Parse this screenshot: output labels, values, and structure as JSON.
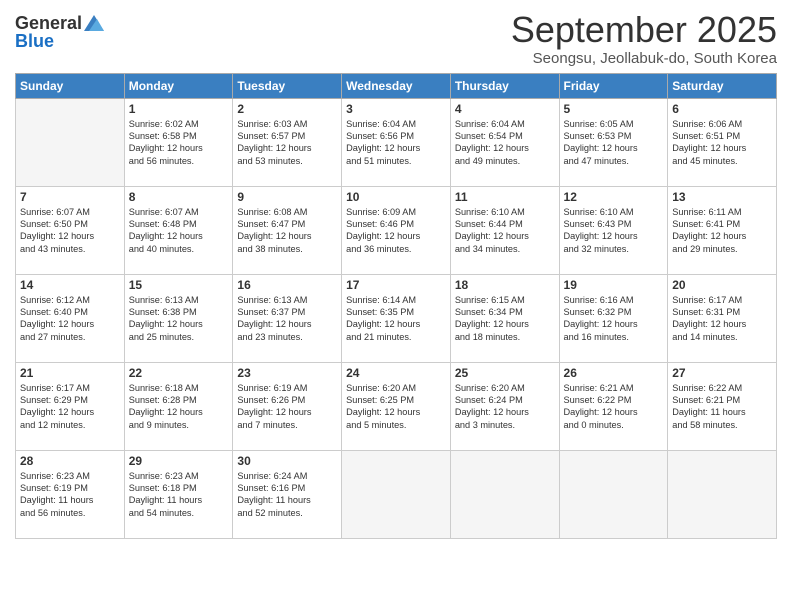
{
  "header": {
    "logo_general": "General",
    "logo_blue": "Blue",
    "month_title": "September 2025",
    "subtitle": "Seongsu, Jeollabuk-do, South Korea"
  },
  "days_of_week": [
    "Sunday",
    "Monday",
    "Tuesday",
    "Wednesday",
    "Thursday",
    "Friday",
    "Saturday"
  ],
  "weeks": [
    [
      {
        "day": "",
        "info": ""
      },
      {
        "day": "1",
        "info": "Sunrise: 6:02 AM\nSunset: 6:58 PM\nDaylight: 12 hours\nand 56 minutes."
      },
      {
        "day": "2",
        "info": "Sunrise: 6:03 AM\nSunset: 6:57 PM\nDaylight: 12 hours\nand 53 minutes."
      },
      {
        "day": "3",
        "info": "Sunrise: 6:04 AM\nSunset: 6:56 PM\nDaylight: 12 hours\nand 51 minutes."
      },
      {
        "day": "4",
        "info": "Sunrise: 6:04 AM\nSunset: 6:54 PM\nDaylight: 12 hours\nand 49 minutes."
      },
      {
        "day": "5",
        "info": "Sunrise: 6:05 AM\nSunset: 6:53 PM\nDaylight: 12 hours\nand 47 minutes."
      },
      {
        "day": "6",
        "info": "Sunrise: 6:06 AM\nSunset: 6:51 PM\nDaylight: 12 hours\nand 45 minutes."
      }
    ],
    [
      {
        "day": "7",
        "info": "Sunrise: 6:07 AM\nSunset: 6:50 PM\nDaylight: 12 hours\nand 43 minutes."
      },
      {
        "day": "8",
        "info": "Sunrise: 6:07 AM\nSunset: 6:48 PM\nDaylight: 12 hours\nand 40 minutes."
      },
      {
        "day": "9",
        "info": "Sunrise: 6:08 AM\nSunset: 6:47 PM\nDaylight: 12 hours\nand 38 minutes."
      },
      {
        "day": "10",
        "info": "Sunrise: 6:09 AM\nSunset: 6:46 PM\nDaylight: 12 hours\nand 36 minutes."
      },
      {
        "day": "11",
        "info": "Sunrise: 6:10 AM\nSunset: 6:44 PM\nDaylight: 12 hours\nand 34 minutes."
      },
      {
        "day": "12",
        "info": "Sunrise: 6:10 AM\nSunset: 6:43 PM\nDaylight: 12 hours\nand 32 minutes."
      },
      {
        "day": "13",
        "info": "Sunrise: 6:11 AM\nSunset: 6:41 PM\nDaylight: 12 hours\nand 29 minutes."
      }
    ],
    [
      {
        "day": "14",
        "info": "Sunrise: 6:12 AM\nSunset: 6:40 PM\nDaylight: 12 hours\nand 27 minutes."
      },
      {
        "day": "15",
        "info": "Sunrise: 6:13 AM\nSunset: 6:38 PM\nDaylight: 12 hours\nand 25 minutes."
      },
      {
        "day": "16",
        "info": "Sunrise: 6:13 AM\nSunset: 6:37 PM\nDaylight: 12 hours\nand 23 minutes."
      },
      {
        "day": "17",
        "info": "Sunrise: 6:14 AM\nSunset: 6:35 PM\nDaylight: 12 hours\nand 21 minutes."
      },
      {
        "day": "18",
        "info": "Sunrise: 6:15 AM\nSunset: 6:34 PM\nDaylight: 12 hours\nand 18 minutes."
      },
      {
        "day": "19",
        "info": "Sunrise: 6:16 AM\nSunset: 6:32 PM\nDaylight: 12 hours\nand 16 minutes."
      },
      {
        "day": "20",
        "info": "Sunrise: 6:17 AM\nSunset: 6:31 PM\nDaylight: 12 hours\nand 14 minutes."
      }
    ],
    [
      {
        "day": "21",
        "info": "Sunrise: 6:17 AM\nSunset: 6:29 PM\nDaylight: 12 hours\nand 12 minutes."
      },
      {
        "day": "22",
        "info": "Sunrise: 6:18 AM\nSunset: 6:28 PM\nDaylight: 12 hours\nand 9 minutes."
      },
      {
        "day": "23",
        "info": "Sunrise: 6:19 AM\nSunset: 6:26 PM\nDaylight: 12 hours\nand 7 minutes."
      },
      {
        "day": "24",
        "info": "Sunrise: 6:20 AM\nSunset: 6:25 PM\nDaylight: 12 hours\nand 5 minutes."
      },
      {
        "day": "25",
        "info": "Sunrise: 6:20 AM\nSunset: 6:24 PM\nDaylight: 12 hours\nand 3 minutes."
      },
      {
        "day": "26",
        "info": "Sunrise: 6:21 AM\nSunset: 6:22 PM\nDaylight: 12 hours\nand 0 minutes."
      },
      {
        "day": "27",
        "info": "Sunrise: 6:22 AM\nSunset: 6:21 PM\nDaylight: 11 hours\nand 58 minutes."
      }
    ],
    [
      {
        "day": "28",
        "info": "Sunrise: 6:23 AM\nSunset: 6:19 PM\nDaylight: 11 hours\nand 56 minutes."
      },
      {
        "day": "29",
        "info": "Sunrise: 6:23 AM\nSunset: 6:18 PM\nDaylight: 11 hours\nand 54 minutes."
      },
      {
        "day": "30",
        "info": "Sunrise: 6:24 AM\nSunset: 6:16 PM\nDaylight: 11 hours\nand 52 minutes."
      },
      {
        "day": "",
        "info": ""
      },
      {
        "day": "",
        "info": ""
      },
      {
        "day": "",
        "info": ""
      },
      {
        "day": "",
        "info": ""
      }
    ]
  ]
}
